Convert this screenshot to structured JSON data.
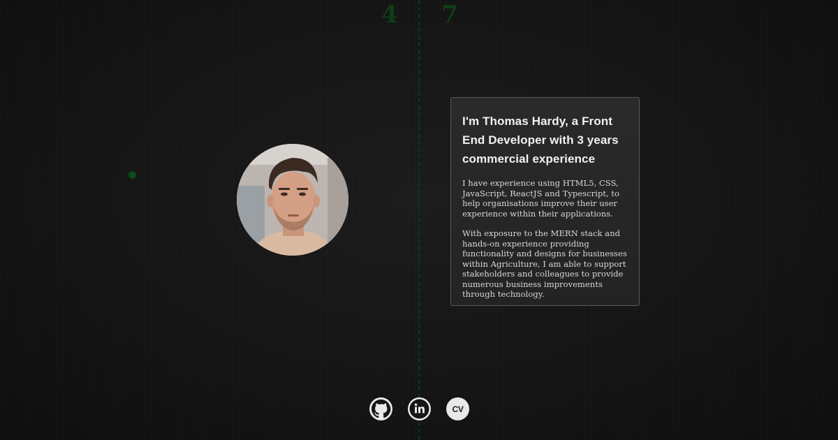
{
  "background": {
    "digits": [
      "4",
      "7"
    ],
    "accent_color": "#0d4a18"
  },
  "profile": {
    "avatar_alt": "Thomas Hardy"
  },
  "about": {
    "heading": "I'm Thomas Hardy, a Front End Developer with 3 years commercial experience",
    "paragraphs": [
      "I have experience using HTML5, CSS, JavaScript, ReactJS and Typescript, to help organisations improve their user experience within their applications.",
      "With exposure to the MERN stack and hands-on experience providing functionality and designs for businesses within Agriculture, I am able to support stakeholders and colleagues to provide numerous business improvements through technology."
    ]
  },
  "socials": [
    {
      "icon": "github-icon",
      "label": "GitHub"
    },
    {
      "icon": "linkedin-icon",
      "label": "LinkedIn"
    },
    {
      "icon": "cv-icon",
      "text": "CV"
    }
  ]
}
